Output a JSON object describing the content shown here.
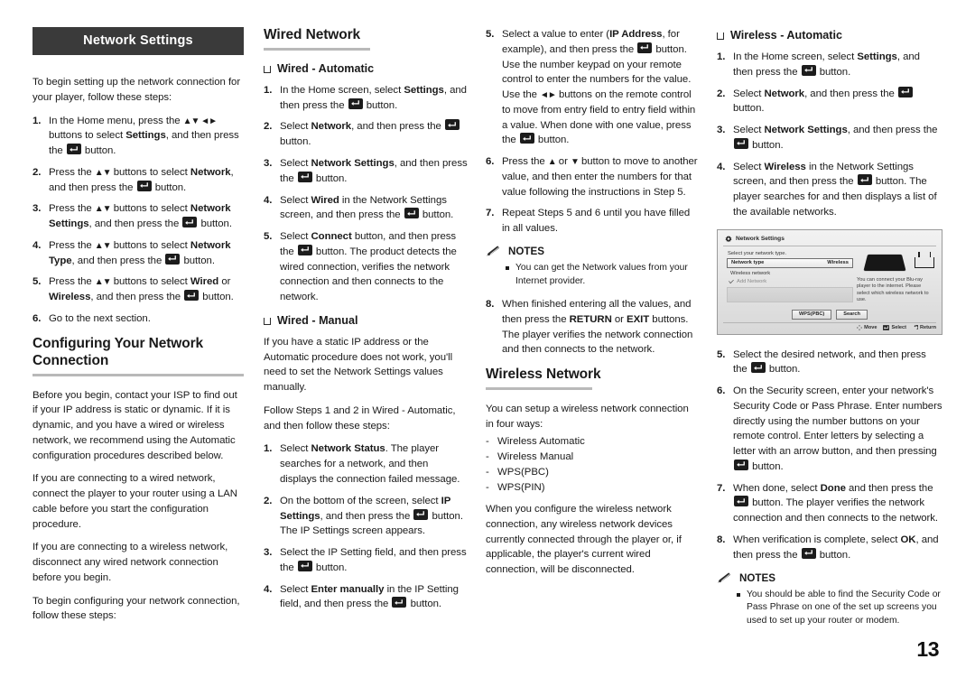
{
  "page_number": "13",
  "banner": {
    "title": "Network Settings"
  },
  "column1": {
    "intro": "To begin setting up the network connection for your player, follow these steps:",
    "steps": [
      {
        "num": "1.",
        "parts": [
          {
            "t": "In the Home menu, press the "
          },
          {
            "t": "▲▼ ◄►",
            "s": "arrow"
          },
          {
            "t": " buttons to select "
          },
          {
            "t": "Settings",
            "s": "b"
          },
          {
            "t": ", and then press the "
          },
          {
            "t": "",
            "s": "ebtn"
          },
          {
            "t": " button."
          }
        ]
      },
      {
        "num": "2.",
        "parts": [
          {
            "t": "Press the "
          },
          {
            "t": "▲▼",
            "s": "arrow"
          },
          {
            "t": " buttons to select "
          },
          {
            "t": "Network",
            "s": "b"
          },
          {
            "t": ", and then press the "
          },
          {
            "t": "",
            "s": "ebtn"
          },
          {
            "t": " button."
          }
        ]
      },
      {
        "num": "3.",
        "parts": [
          {
            "t": "Press the "
          },
          {
            "t": "▲▼",
            "s": "arrow"
          },
          {
            "t": " buttons to select "
          },
          {
            "t": "Network Settings",
            "s": "b"
          },
          {
            "t": ", and then press the "
          },
          {
            "t": "",
            "s": "ebtn"
          },
          {
            "t": " button."
          }
        ]
      },
      {
        "num": "4.",
        "parts": [
          {
            "t": "Press the "
          },
          {
            "t": "▲▼",
            "s": "arrow"
          },
          {
            "t": " buttons to select "
          },
          {
            "t": "Network Type",
            "s": "b"
          },
          {
            "t": ", and then press the "
          },
          {
            "t": "",
            "s": "ebtn"
          },
          {
            "t": " button."
          }
        ]
      },
      {
        "num": "5.",
        "parts": [
          {
            "t": "Press the "
          },
          {
            "t": "▲▼",
            "s": "arrow"
          },
          {
            "t": " buttons to select "
          },
          {
            "t": "Wired",
            "s": "b"
          },
          {
            "t": " or "
          },
          {
            "t": "Wireless",
            "s": "b"
          },
          {
            "t": ", and then press the "
          },
          {
            "t": "",
            "s": "ebtn"
          },
          {
            "t": " button."
          }
        ]
      },
      {
        "num": "6.",
        "parts": [
          {
            "t": "Go to the next section."
          }
        ]
      }
    ],
    "heading": "Configuring Your Network Connection",
    "paragraphs": [
      "Before you begin, contact your ISP to find out if your IP address is static or dynamic. If it is dynamic, and you have a wired or wireless network, we recommend using the Automatic configuration procedures described below.",
      "If you are connecting to a wired network, connect the player to your router using a LAN cable before you start the configuration procedure.",
      "If you are connecting to a wireless network, disconnect any wired network connection before you begin.",
      "To begin configuring your network connection, follow these steps:"
    ]
  },
  "column2": {
    "heading": "Wired Network",
    "sub_automatic": "Wired - Automatic",
    "steps_automatic": [
      {
        "num": "1.",
        "parts": [
          {
            "t": "In the Home screen, select "
          },
          {
            "t": "Settings",
            "s": "b"
          },
          {
            "t": ", and then press the "
          },
          {
            "t": "",
            "s": "ebtn"
          },
          {
            "t": " button."
          }
        ]
      },
      {
        "num": "2.",
        "parts": [
          {
            "t": "Select "
          },
          {
            "t": "Network",
            "s": "b"
          },
          {
            "t": ", and then press the "
          },
          {
            "t": "",
            "s": "ebtn"
          },
          {
            "t": " button."
          }
        ]
      },
      {
        "num": "3.",
        "parts": [
          {
            "t": "Select "
          },
          {
            "t": "Network Settings",
            "s": "b"
          },
          {
            "t": ", and then press the "
          },
          {
            "t": "",
            "s": "ebtn"
          },
          {
            "t": " button."
          }
        ]
      },
      {
        "num": "4.",
        "parts": [
          {
            "t": "Select "
          },
          {
            "t": "Wired",
            "s": "b"
          },
          {
            "t": " in the Network Settings screen, and then press the "
          },
          {
            "t": "",
            "s": "ebtn"
          },
          {
            "t": " button."
          }
        ]
      },
      {
        "num": "5.",
        "parts": [
          {
            "t": "Select "
          },
          {
            "t": "Connect",
            "s": "b"
          },
          {
            "t": " button, and then press the "
          },
          {
            "t": "",
            "s": "ebtn"
          },
          {
            "t": " button. The product detects the wired connection, verifies the network connection and then connects to the network."
          }
        ]
      }
    ],
    "sub_manual": "Wired - Manual",
    "manual_intro1": "If you have a static IP address or the Automatic procedure does not work, you'll need to set the Network Settings values manually.",
    "manual_intro2": "Follow Steps 1 and 2 in Wired - Automatic, and then follow these steps:",
    "steps_manual": [
      {
        "num": "1.",
        "parts": [
          {
            "t": "Select "
          },
          {
            "t": "Network Status",
            "s": "b"
          },
          {
            "t": ". The player searches for a network, and then displays the connection failed message."
          }
        ]
      },
      {
        "num": "2.",
        "parts": [
          {
            "t": "On the bottom of the screen, select "
          },
          {
            "t": "IP Settings",
            "s": "b"
          },
          {
            "t": ", and then press the "
          },
          {
            "t": "",
            "s": "ebtn"
          },
          {
            "t": " button. The IP Settings screen appears."
          }
        ]
      },
      {
        "num": "3.",
        "parts": [
          {
            "t": "Select the IP Setting field, and then press the "
          },
          {
            "t": "",
            "s": "ebtn"
          },
          {
            "t": " button."
          }
        ]
      },
      {
        "num": "4.",
        "parts": [
          {
            "t": "Select "
          },
          {
            "t": "Enter manually",
            "s": "b"
          },
          {
            "t": " in the IP Setting field, and then press the "
          },
          {
            "t": "",
            "s": "ebtn"
          },
          {
            "t": " button."
          }
        ]
      }
    ]
  },
  "column3": {
    "steps_continued": [
      {
        "num": "5.",
        "parts": [
          {
            "t": "Select a value to enter ("
          },
          {
            "t": "IP Address",
            "s": "b"
          },
          {
            "t": ", for example), and then press the "
          },
          {
            "t": "",
            "s": "ebtn"
          },
          {
            "t": " button. Use the number keypad on your remote control to enter the numbers for the value. Use the "
          },
          {
            "t": "◄►",
            "s": "arrow"
          },
          {
            "t": " buttons on the remote control to move from entry field to entry field within a value. When done with one value, press the "
          },
          {
            "t": "",
            "s": "ebtn"
          },
          {
            "t": " button."
          }
        ]
      },
      {
        "num": "6.",
        "parts": [
          {
            "t": "Press the "
          },
          {
            "t": "▲",
            "s": "arrow"
          },
          {
            "t": " or "
          },
          {
            "t": "▼",
            "s": "arrow"
          },
          {
            "t": " button to move to another value, and then enter the numbers for that value following the instructions in Step 5."
          }
        ]
      },
      {
        "num": "7.",
        "parts": [
          {
            "t": "Repeat Steps 5 and 6 until you have filled in all values."
          }
        ]
      }
    ],
    "notes_label": "NOTES",
    "notes": [
      "You can get the Network values from your Internet provider."
    ],
    "steps_after_notes": [
      {
        "num": "8.",
        "parts": [
          {
            "t": "When finished entering all the values, and then press the "
          },
          {
            "t": "RETURN",
            "s": "b"
          },
          {
            "t": " or "
          },
          {
            "t": "EXIT",
            "s": "b"
          },
          {
            "t": " buttons. The player verifies the network connection and then connects to the network."
          }
        ]
      }
    ],
    "wireless_heading": "Wireless Network",
    "wireless_intro": "You can setup a wireless network connection in four ways:",
    "wireless_ways": [
      "Wireless Automatic",
      "Wireless Manual",
      "WPS(PBC)",
      "WPS(PIN)"
    ],
    "wireless_note": "When you configure the wireless network connection, any wireless network devices currently connected through the player or, if applicable, the player's current wired connection, will be disconnected."
  },
  "column4": {
    "sub_wireless_automatic": "Wireless - Automatic",
    "steps": [
      {
        "num": "1.",
        "parts": [
          {
            "t": "In the Home screen, select "
          },
          {
            "t": "Settings",
            "s": "b"
          },
          {
            "t": ", and then press the "
          },
          {
            "t": "",
            "s": "ebtn"
          },
          {
            "t": " button."
          }
        ]
      },
      {
        "num": "2.",
        "parts": [
          {
            "t": "Select "
          },
          {
            "t": "Network",
            "s": "b"
          },
          {
            "t": ", and then press the "
          },
          {
            "t": "",
            "s": "ebtn"
          },
          {
            "t": " button."
          }
        ]
      },
      {
        "num": "3.",
        "parts": [
          {
            "t": "Select "
          },
          {
            "t": "Network Settings",
            "s": "b"
          },
          {
            "t": ", and then press the "
          },
          {
            "t": "",
            "s": "ebtn"
          },
          {
            "t": " button."
          }
        ]
      },
      {
        "num": "4.",
        "parts": [
          {
            "t": "Select "
          },
          {
            "t": "Wireless",
            "s": "b"
          },
          {
            "t": " in the Network Settings screen, and then press the "
          },
          {
            "t": "",
            "s": "ebtn"
          },
          {
            "t": " button. The player searches for and then displays a list of the available networks."
          }
        ]
      }
    ],
    "screenshot": {
      "title": "Network Settings",
      "prompt": "Select your network type.",
      "row_label": "Network type",
      "row_value": "Wireless",
      "section_label": "Wireless network",
      "add_network": "Add Network",
      "hint": "You can connect your Blu-ray player to the internet. Please select which wireless network to use.",
      "buttons": [
        "WPS(PBC)",
        "Search"
      ],
      "footer": [
        "Move",
        "Select",
        "Return"
      ]
    },
    "steps_after": [
      {
        "num": "5.",
        "parts": [
          {
            "t": "Select the desired network, and then press the "
          },
          {
            "t": "",
            "s": "ebtn"
          },
          {
            "t": " button."
          }
        ]
      },
      {
        "num": "6.",
        "parts": [
          {
            "t": "On the Security screen, enter your network's Security Code or Pass Phrase. Enter numbers directly using the number buttons on your remote control. Enter letters by selecting a letter with an arrow button, and then pressing "
          },
          {
            "t": "",
            "s": "ebtn"
          },
          {
            "t": " button."
          }
        ]
      },
      {
        "num": "7.",
        "parts": [
          {
            "t": "When done, select "
          },
          {
            "t": "Done",
            "s": "b"
          },
          {
            "t": " and then press the "
          },
          {
            "t": "",
            "s": "ebtn"
          },
          {
            "t": " button. The player verifies the network connection and then connects to the network."
          }
        ]
      },
      {
        "num": "8.",
        "parts": [
          {
            "t": "When verification is complete, select "
          },
          {
            "t": "OK",
            "s": "b"
          },
          {
            "t": ", and then press the "
          },
          {
            "t": "",
            "s": "ebtn"
          },
          {
            "t": " button."
          }
        ]
      }
    ],
    "notes_label": "NOTES",
    "notes": [
      "You should be able to find the Security Code or Pass Phrase on one of the set up screens you used to set up your router or modem."
    ]
  }
}
